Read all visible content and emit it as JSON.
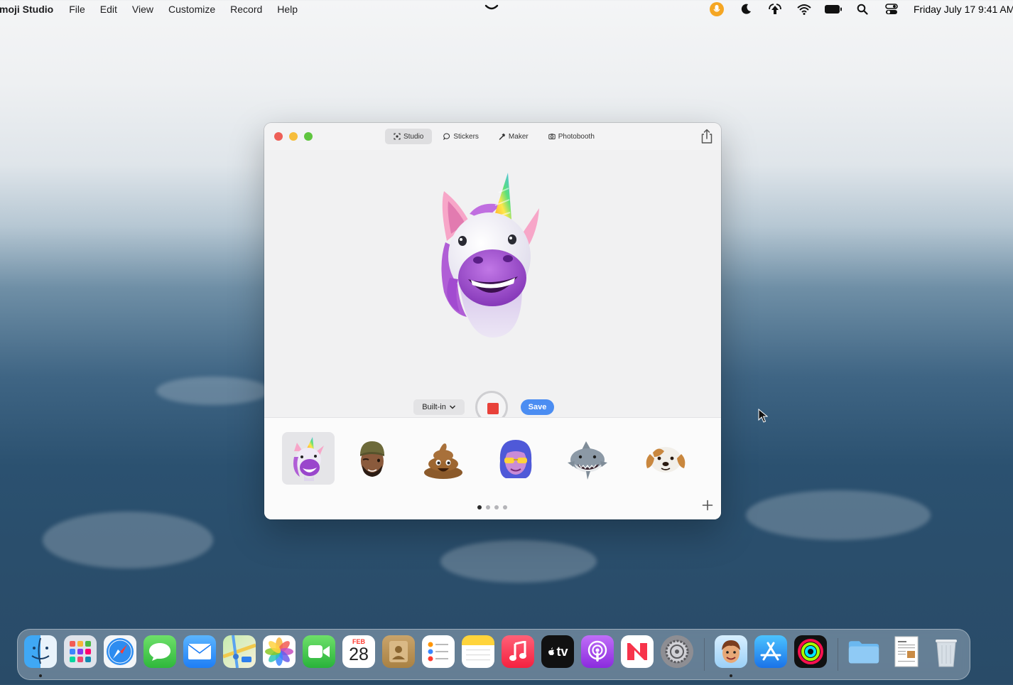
{
  "menubar": {
    "app_name": "moji Studio",
    "menus": [
      "File",
      "Edit",
      "View",
      "Customize",
      "Record",
      "Help"
    ],
    "clock": "Friday July 17  9:41 AM"
  },
  "window": {
    "tabs": [
      {
        "label": "Studio",
        "icon": "studio-icon",
        "active": true
      },
      {
        "label": "Stickers",
        "icon": "sticker-bubble-icon",
        "active": false
      },
      {
        "label": "Maker",
        "icon": "hammer-icon",
        "active": false
      },
      {
        "label": "Photobooth",
        "icon": "camera-icon",
        "active": false
      }
    ],
    "controls": {
      "camera_source": "Built-in",
      "save_label": "Save"
    },
    "tray": {
      "avatars": [
        "unicorn",
        "memoji-man-beanie",
        "poop",
        "memoji-woman-sunglasses",
        "shark",
        "dog"
      ],
      "selected_index": 0,
      "page_count": 4,
      "current_page": 0
    }
  },
  "dock": {
    "apps": [
      "Finder",
      "Launchpad",
      "Safari",
      "Messages",
      "Mail",
      "Maps",
      "Photos",
      "FaceTime",
      "Calendar",
      "Contacts",
      "Reminders",
      "Notes",
      "Music",
      "TV",
      "Podcasts",
      "News",
      "System Settings",
      "Memoji Studio",
      "App Store",
      "Fitness",
      "Folder",
      "Document",
      "Trash"
    ],
    "calendar_month": "FEB",
    "calendar_day": "28",
    "tv_label": "tv"
  },
  "colors": {
    "accent_blue": "#4b8df2",
    "record_red": "#e8413a",
    "close": "#ee5f57",
    "minimize": "#f6bd3b",
    "zoom": "#5fc53f"
  }
}
